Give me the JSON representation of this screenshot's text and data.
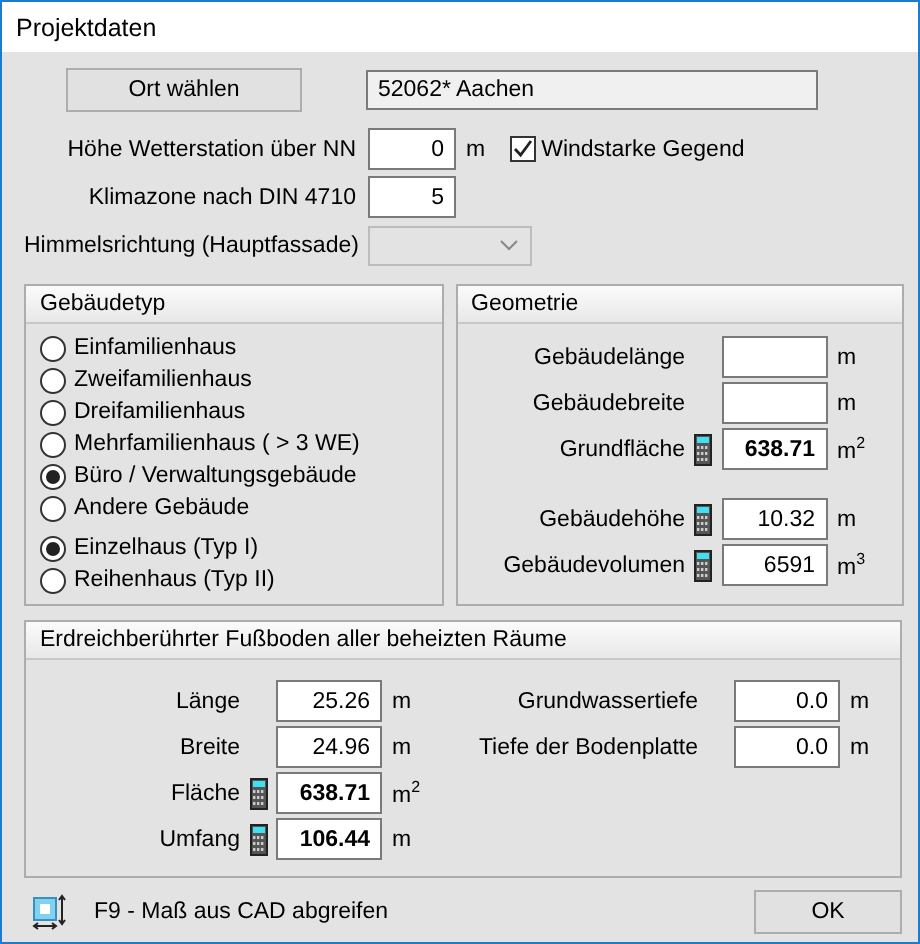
{
  "window": {
    "title": "Projektdaten"
  },
  "location": {
    "button": "Ort wählen",
    "value": "52062* Aachen"
  },
  "weather_station": {
    "label": "Höhe Wetterstation über NN",
    "value": "0",
    "unit": "m"
  },
  "windy": {
    "label": "Windstarke Gegend",
    "checked": true
  },
  "climate_zone": {
    "label": "Klimazone nach DIN 4710",
    "value": "5"
  },
  "orientation": {
    "label": "Himmelsrichtung (Hauptfassade)",
    "disabled": true
  },
  "building_type": {
    "title": "Gebäudetyp",
    "options": [
      {
        "label": "Einfamilienhaus",
        "selected": false
      },
      {
        "label": "Zweifamilienhaus",
        "selected": false
      },
      {
        "label": "Dreifamilienhaus",
        "selected": false
      },
      {
        "label": "Mehrfamilienhaus ( > 3 WE)",
        "selected": false
      },
      {
        "label": "Büro / Verwaltungsgebäude",
        "selected": true
      },
      {
        "label": "Andere Gebäude",
        "selected": false
      }
    ],
    "house_types": [
      {
        "label": "Einzelhaus (Typ I)",
        "selected": true
      },
      {
        "label": "Reihenhaus (Typ II)",
        "selected": false
      }
    ]
  },
  "geometry": {
    "title": "Geometrie",
    "base_fields": [
      {
        "label": "Gebäudelänge",
        "unit": "m",
        "calculated": false
      },
      {
        "label": "Gebäudebreite",
        "unit": "m",
        "calculated": false
      },
      {
        "label": "Grundfläche",
        "value": "638.71",
        "unit": "m$^{2}$",
        "calculated": true,
        "bold": true
      }
    ],
    "height_fields": [
      {
        "label": "Gebäudehöhe",
        "value": "10.32",
        "unit": "m",
        "calculated": true,
        "bold": false
      },
      {
        "label": "Gebäudevolumen",
        "value": "6591",
        "unit": "m$^{3}$",
        "calculated": true,
        "bold": false
      }
    ]
  },
  "floor": {
    "title": "Erdreichberührter Fußboden aller beheizten Räume",
    "fields": [
      {
        "label": "Länge",
        "value": "25.26",
        "unit": "m",
        "calculated": false,
        "bold": false
      },
      {
        "label": "Breite",
        "value": "24.96",
        "unit": "m",
        "calculated": false,
        "bold": false
      },
      {
        "label": "Fläche",
        "value": "638.71",
        "unit": "m$^{2}$",
        "calculated": true,
        "bold": true
      },
      {
        "label": "Umfang",
        "value": "106.44",
        "unit": "m",
        "calculated": true,
        "bold": true
      }
    ],
    "ground_fields": [
      {
        "label": "Grundwassertiefe",
        "value": "0.0",
        "unit": "m",
        "calculated": false,
        "bold": false
      },
      {
        "label": "Tiefe der Bodenplatte",
        "value": "0.0",
        "unit": "m",
        "calculated": false,
        "bold": false
      }
    ]
  },
  "footer": {
    "hint": "F9 - Maß aus CAD abgreifen",
    "ok": "OK"
  }
}
